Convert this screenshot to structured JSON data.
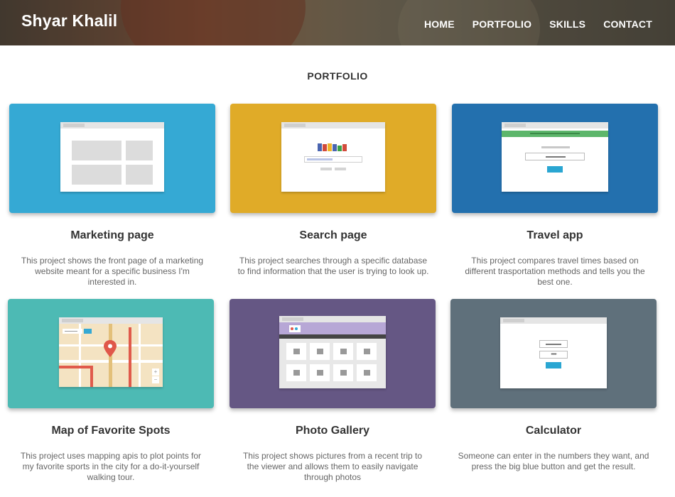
{
  "header": {
    "brand": "Shyar Khalil",
    "nav": [
      "HOME",
      "PORTFOLIO",
      "SKILLS",
      "CONTACT"
    ]
  },
  "section": {
    "title": "PORTFOLIO"
  },
  "colors": {
    "marketing": "#35a9d4",
    "search": "#e0ab28",
    "travel": "#2370ae",
    "map": "#4dbab4",
    "gallery": "#655784",
    "calculator": "#5f707b"
  },
  "projects": [
    {
      "title": "Marketing page",
      "desc": "This project shows the front page of a marketing website meant for a specific business I'm interested in."
    },
    {
      "title": "Search page",
      "desc": "This project searches through a specific database to find information that the user is trying to look up."
    },
    {
      "title": "Travel app",
      "desc": "This project compares travel times based on different trasportation methods and tells you the best one."
    },
    {
      "title": "Map of Favorite Spots",
      "desc": "This project uses mapping apis to plot points for my favorite sports in the city for a do-it-yourself walking tour."
    },
    {
      "title": "Photo Gallery",
      "desc": "This project shows pictures from a recent trip to the viewer and allows them to easily navigate through photos"
    },
    {
      "title": "Calculator",
      "desc": "Someone can enter in the numbers they want, and press the big blue button and get the result."
    }
  ],
  "icons": [
    "map-pin-icon",
    "zoom-plus-icon",
    "zoom-minus-icon"
  ]
}
